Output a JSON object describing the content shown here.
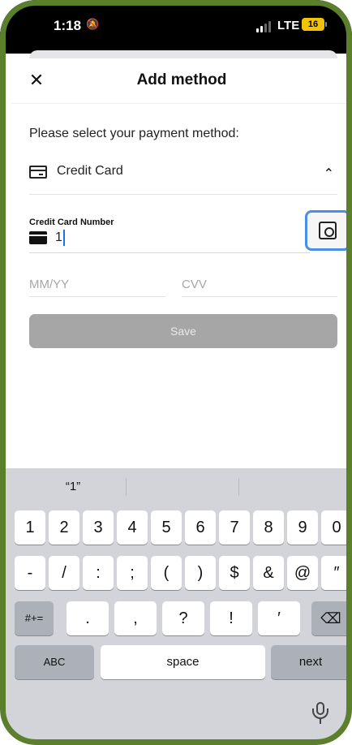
{
  "status_bar": {
    "time": "1:18",
    "network": "LTE",
    "battery": "16"
  },
  "header": {
    "title": "Add method",
    "close_label": "✕"
  },
  "prompt": "Please select your payment method:",
  "payment_method": {
    "label": "Credit Card",
    "expanded": true
  },
  "card_form": {
    "number_label": "Credit Card Number",
    "number_value": "1",
    "expiry_placeholder": "MM/YY",
    "cvv_placeholder": "CVV",
    "save_label": "Save"
  },
  "keyboard": {
    "suggestion": "“1”",
    "number_row": [
      "1",
      "2",
      "3",
      "4",
      "5",
      "6",
      "7",
      "8",
      "9",
      "0"
    ],
    "symbol_row": [
      "-",
      "/",
      ":",
      ";",
      "(",
      ")",
      "$",
      "&",
      "@",
      "″"
    ],
    "punct_row": [
      ".",
      ",",
      "?",
      "!",
      "′"
    ],
    "shift_label": "#+=",
    "abc_label": "ABC",
    "space_label": "space",
    "next_label": "next"
  },
  "colors": {
    "bezel": "#5b7f2b",
    "scan_border": "#4a90e2",
    "save_disabled": "#a6a6a6",
    "keyboard_bg": "#d2d4d9"
  }
}
